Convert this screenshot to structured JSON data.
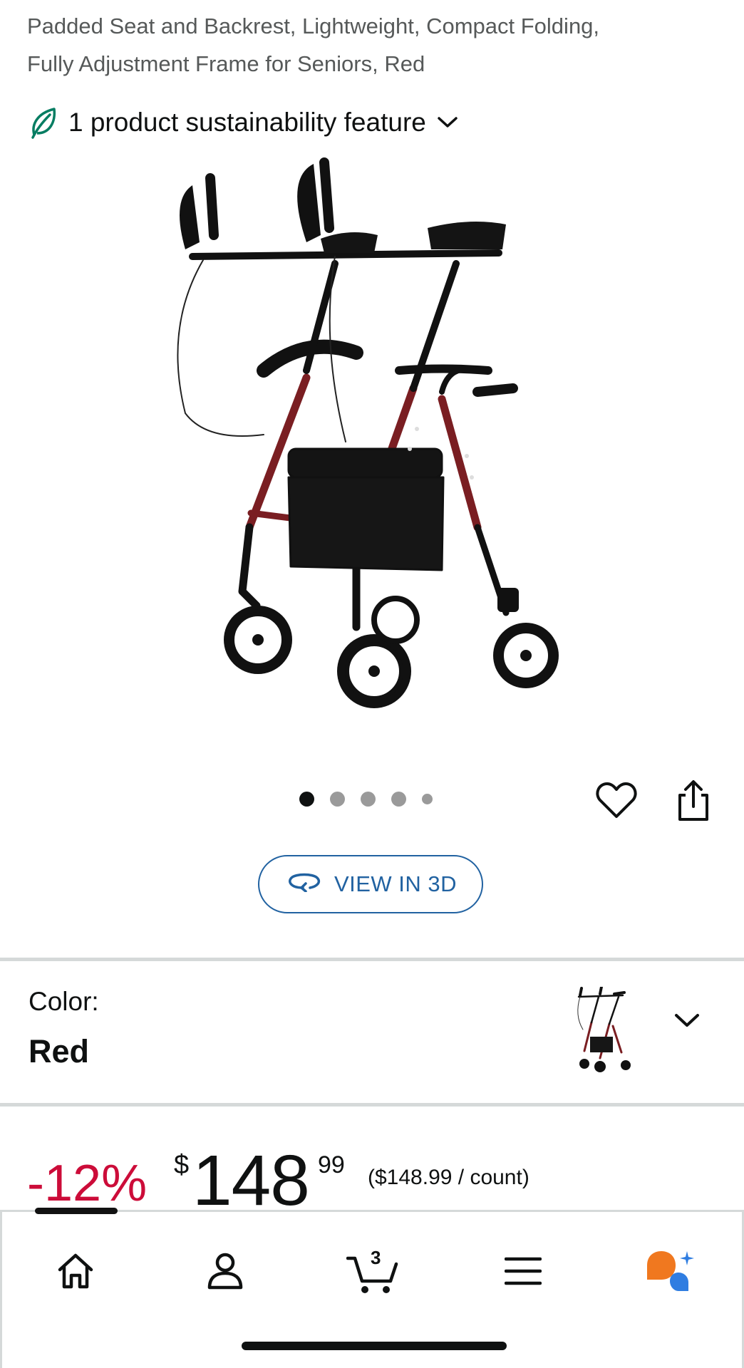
{
  "product": {
    "title_line1": "Padded Seat and Backrest, Lightweight, Compact Folding,",
    "title_line2": "Fully Adjustment Frame for Seniors, Red",
    "sustainability_text": "1 product sustainability feature"
  },
  "gallery": {
    "image_count": 5,
    "active_index": 0,
    "view3d_label": "VIEW IN 3D",
    "image_icon": "upright-rollator-walker-red"
  },
  "variation": {
    "color_label": "Color:",
    "color_value": "Red"
  },
  "price": {
    "discount": "-12%",
    "currency_symbol": "$",
    "whole": "148",
    "fraction": "99",
    "unit_price": "($148.99 / count)"
  },
  "nav": {
    "items": [
      "home-icon",
      "account-icon",
      "cart-icon",
      "menu-icon",
      "rufus-icon"
    ],
    "cart_count": "3"
  },
  "colors": {
    "link_blue": "#2162a1",
    "deal_red": "#cc0c39",
    "sustain_green": "#067d62",
    "divider": "#d5d9d9",
    "frame_red": "#7a1e22"
  }
}
